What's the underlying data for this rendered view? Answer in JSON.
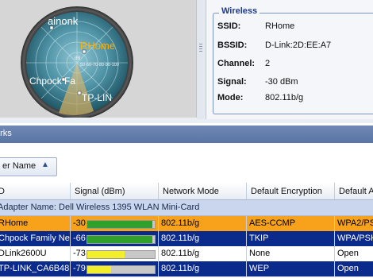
{
  "radar": {
    "networks": [
      {
        "label": "ainonk"
      },
      {
        "label": "RHome"
      },
      {
        "label": "Chpock Fa"
      },
      {
        "label": "TP-LIN"
      }
    ],
    "scale_label": "dB",
    "scale_ticks": "50-60-70-80-90-100",
    "accent_color": "#f29a00"
  },
  "wireless": {
    "title": "Wireless",
    "ssid_label": "SSID:",
    "ssid_value": "RHome",
    "bssid_label": "BSSID:",
    "bssid_value": "D-Link:2D:EE:A7",
    "channel_label": "Channel:",
    "channel_value": "2",
    "signal_label": "Signal:",
    "signal_value": "-30 dBm",
    "mode_label": "Mode:",
    "mode_value": "802.11b/g"
  },
  "networks_header": "orks",
  "group_by": {
    "label": "er Name",
    "sort_icon": "sort-ascending-icon"
  },
  "table": {
    "columns": [
      "D",
      "Signal (dBm)",
      "Network Mode",
      "Default Encryption",
      "Default A"
    ],
    "group_label": "Adapter Name: Dell Wireless 1395 WLAN Mini-Card",
    "rows": [
      {
        "ssid": "RHome",
        "signal": "-30",
        "signal_fraction": 0.97,
        "mode": "802.11b/g",
        "encryption": "AES-CCMP",
        "auth": "WPA2/PS",
        "style": "selected-orange"
      },
      {
        "ssid": "Chpock Family Net",
        "signal": "-66",
        "signal_fraction": 0.97,
        "mode": "802.11b/g",
        "encryption": "TKIP",
        "auth": "WPA/PSK",
        "style": "selected-blue"
      },
      {
        "ssid": "DLink2600U",
        "signal": "-73",
        "signal_fraction": 0.55,
        "mode": "802.11b/g",
        "encryption": "None",
        "auth": "Open",
        "style": "normal"
      },
      {
        "ssid": "TP-LINK_CA6B48",
        "signal": "-79",
        "signal_fraction": 0.35,
        "mode": "802.11b/g",
        "encryption": "WEP",
        "auth": "Open",
        "style": "selected-blue"
      }
    ]
  },
  "colors": {
    "row_orange": "#f7a21a",
    "row_blue": "#0a2a8c",
    "bar_green": "#2fa02a",
    "bar_yellow": "#f2ee2a"
  }
}
